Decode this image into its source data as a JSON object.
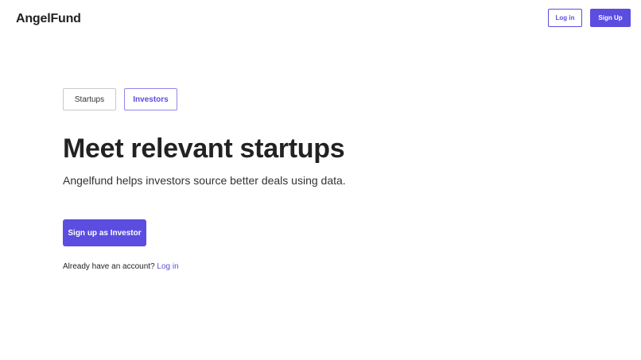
{
  "header": {
    "brand": "AngelFund",
    "login_label": "Log in",
    "signup_label": "Sign Up"
  },
  "tabs": [
    {
      "label": "Startups",
      "selected": false
    },
    {
      "label": "Investors",
      "selected": true
    }
  ],
  "hero": {
    "headline": "Meet relevant startups",
    "subheadline": "Angelfund helps investors source better deals using data.",
    "cta_label": "Sign up as Investor"
  },
  "account": {
    "prompt": "Already have an account?",
    "link_label": "Log in"
  },
  "colors": {
    "accent": "#5b4de0",
    "text": "#222222",
    "background": "#ffffff"
  }
}
